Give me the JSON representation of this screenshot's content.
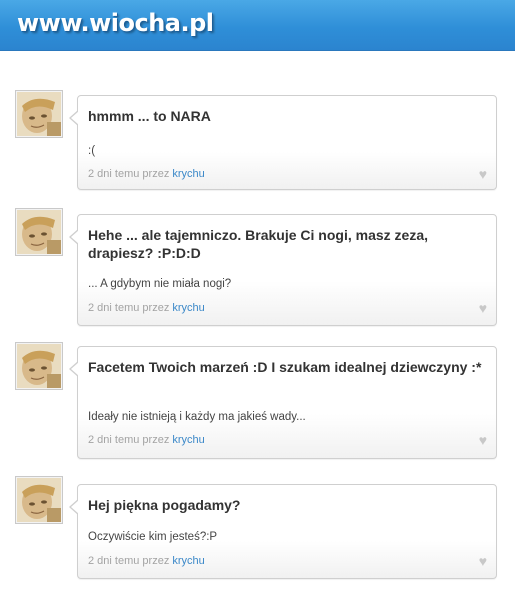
{
  "site": {
    "logo": "www.wiocha.pl"
  },
  "avatar_icon": "user-photo",
  "posts": [
    {
      "title": "hmmm ... to NARA",
      "reply": ":(",
      "time": "2 dni temu przez",
      "user": "krychu"
    },
    {
      "title": "Hehe ... ale tajemniczo. Brakuje Ci nogi, masz zeza, drapiesz? :P:D:D",
      "reply": "... A gdybym nie miała nogi?",
      "time": "2 dni temu przez",
      "user": "krychu"
    },
    {
      "title": "Facetem Twoich marzeń :D I szukam idealnej dziewczyny :*",
      "reply": "Ideały nie istnieją i każdy ma jakieś wady...",
      "time": "2 dni temu przez",
      "user": "krychu"
    },
    {
      "title": "Hej piękna pogadamy?",
      "reply": "Oczywiście kim jesteś?:P",
      "time": "2 dni temu przez",
      "user": "krychu"
    }
  ]
}
